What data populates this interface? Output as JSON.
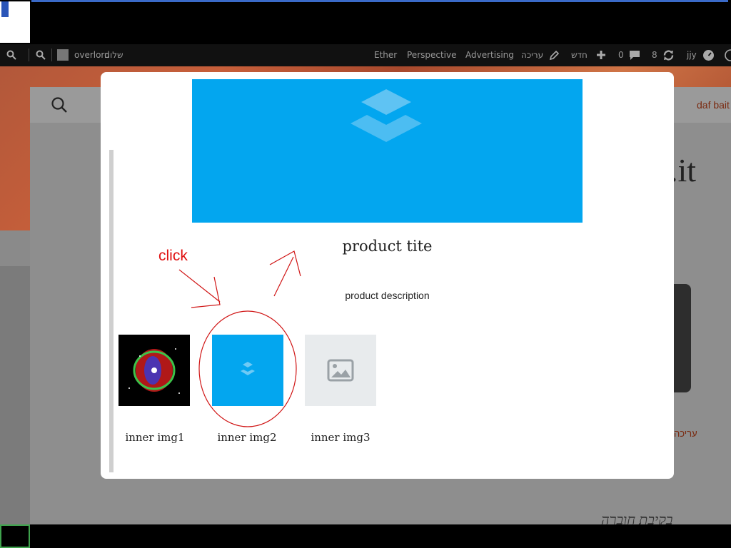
{
  "adminbar": {
    "user_name": "overlord",
    "greeting": "שלום",
    "links": [
      "Ether",
      "Perspective",
      "Advertising"
    ],
    "edit_label": "עריכה",
    "new_label": "חדש",
    "comments_count": "0",
    "updates_count": "8",
    "site_name": "jjy"
  },
  "background": {
    "nav_text": "daf bait",
    "heading_fragment": ".it",
    "edit_link": "עריכה",
    "footer_heading": "בקיבת חוברה"
  },
  "modal": {
    "product_title": "product tite",
    "product_description": "product description",
    "thumbnails": [
      {
        "label": "inner img1",
        "icon": "nebula-photo"
      },
      {
        "label": "inner img2",
        "icon": "layers-icon"
      },
      {
        "label": "inner img3",
        "icon": "image-placeholder-icon"
      }
    ],
    "banner_icon": "layers-icon",
    "accent_color": "#03a6ef"
  },
  "annotation": {
    "click_text": "click",
    "color": "#e01010"
  }
}
